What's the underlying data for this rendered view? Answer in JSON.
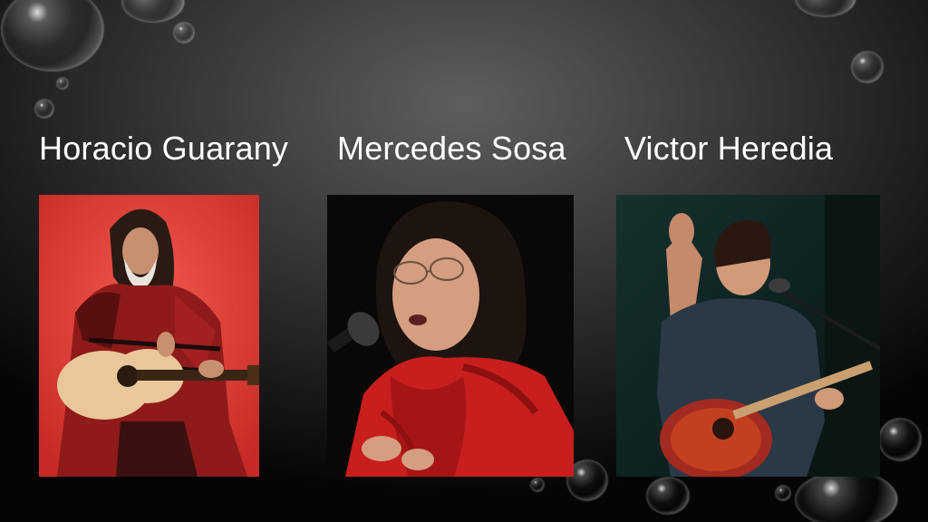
{
  "slide": {
    "captions": [
      "Horacio Guarany",
      "Mercedes Sosa",
      "Victor Heredia"
    ],
    "photos": [
      "guitarist in red poncho photo",
      "singer in red scarf photo",
      "guitarist on stage photo"
    ]
  },
  "colors": {
    "text": "#ffffff",
    "background_center": "#5e5e5e",
    "background_edge": "#050505"
  }
}
